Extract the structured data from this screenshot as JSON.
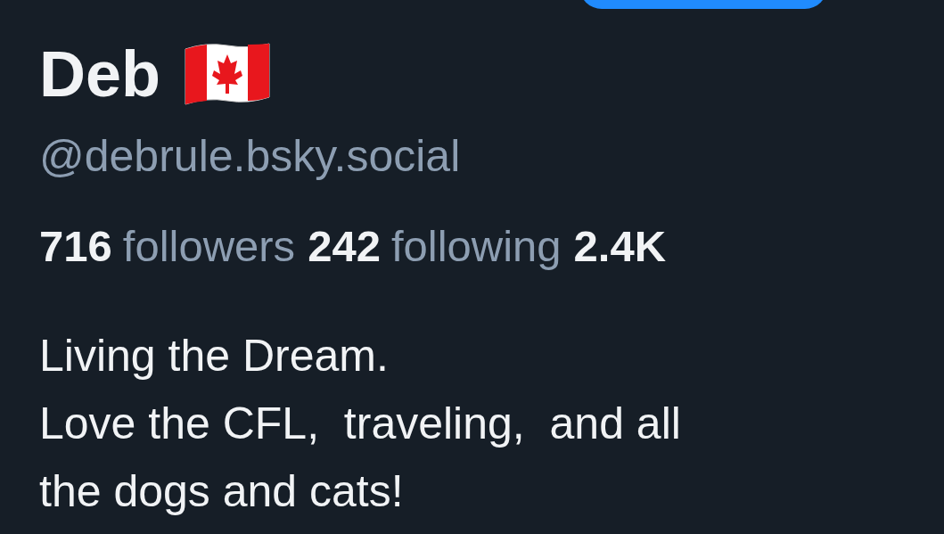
{
  "profile": {
    "name": "Deb",
    "handle": "@debrule.bsky.social",
    "stats": [
      {
        "count": "716",
        "label": "followers"
      },
      {
        "count": "242",
        "label": "following"
      },
      {
        "count": "2.4K"
      }
    ],
    "bio": [
      "Living the Dream.",
      "Love the CFL,  traveling,  and all",
      "the dogs and cats!"
    ]
  }
}
